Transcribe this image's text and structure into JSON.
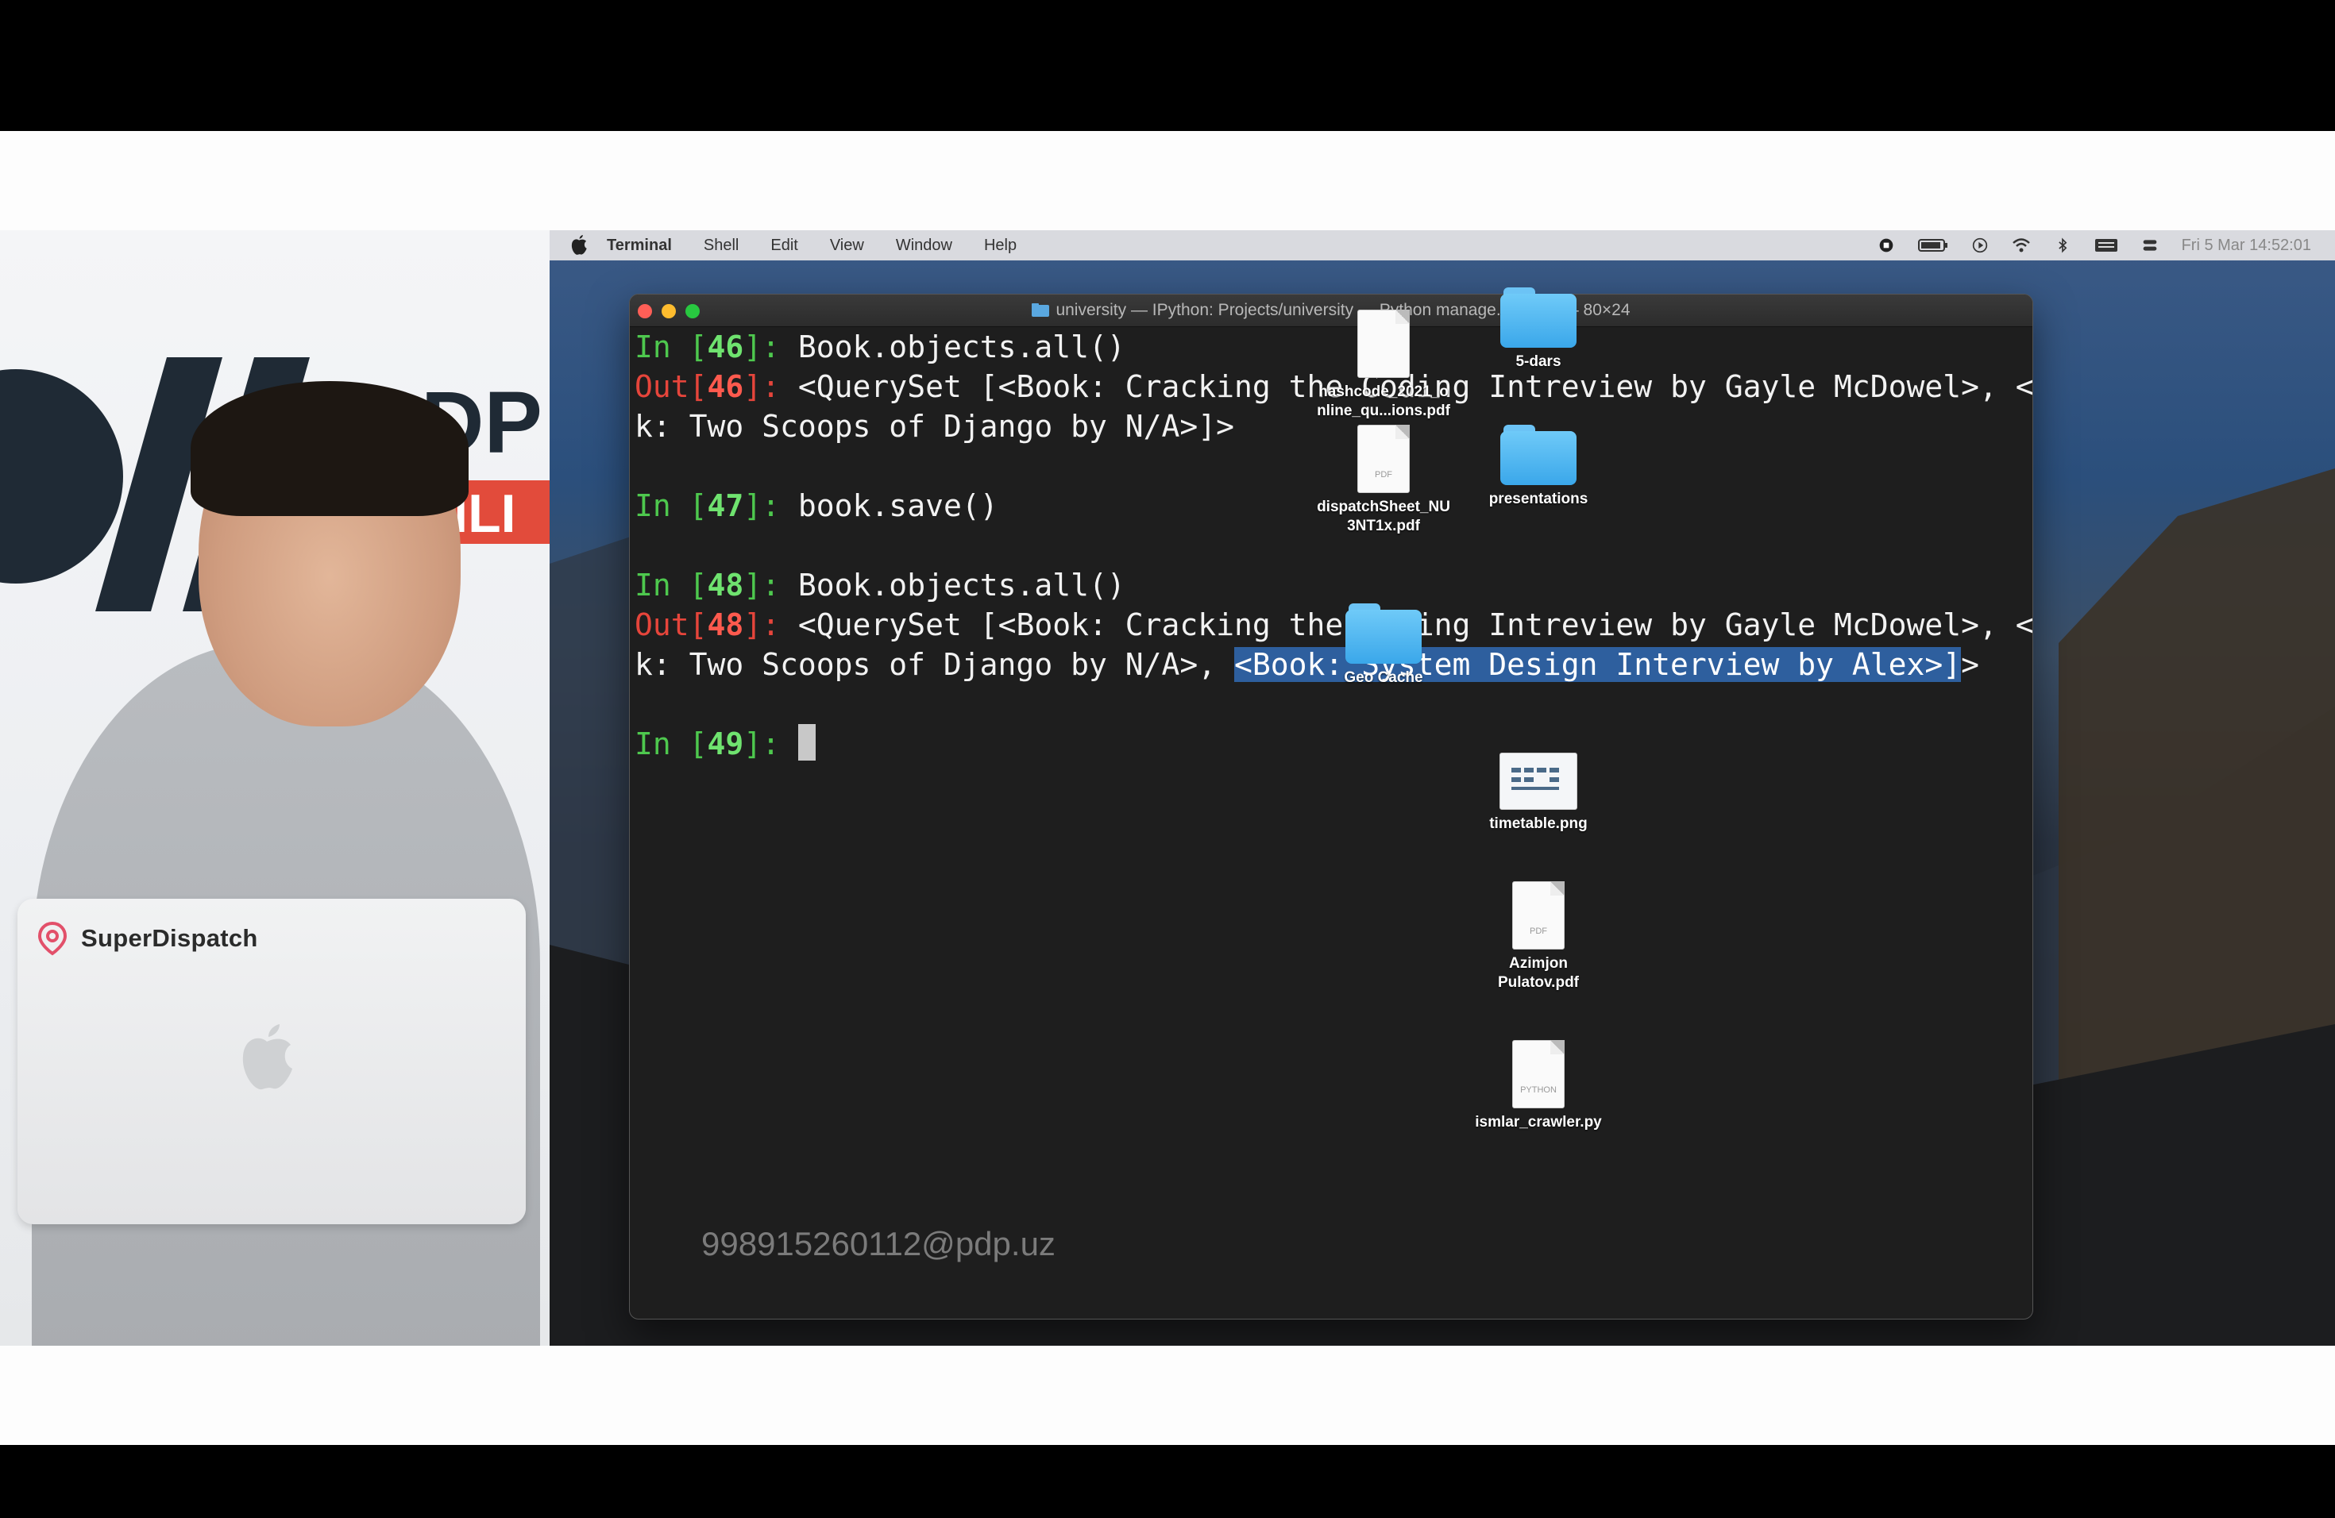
{
  "sticker": {
    "brand": "SuperDispatch"
  },
  "menubar": {
    "app": "Terminal",
    "items": [
      "Shell",
      "Edit",
      "View",
      "Window",
      "Help"
    ],
    "clock": "Fri 5 Mar  14:52:01"
  },
  "terminal": {
    "title": "university — IPython: Projects/university — Python manage.py shell — 80×24",
    "lines": [
      {
        "type": "in",
        "label": "In [",
        "num": "46",
        "close": "]: ",
        "text": "Book.objects.all()"
      },
      {
        "type": "out",
        "label": "Out[",
        "num": "46",
        "close": "]: ",
        "text": "<QuerySet [<Book: Cracking the Coding Intreview by Gayle McDowel>, <Boo"
      },
      {
        "type": "cont",
        "text": "k: Two Scoops of Django by N/A>]>"
      },
      {
        "type": "blank"
      },
      {
        "type": "in",
        "label": "In [",
        "num": "47",
        "close": "]: ",
        "text": "book.save()"
      },
      {
        "type": "blank"
      },
      {
        "type": "in",
        "label": "In [",
        "num": "48",
        "close": "]: ",
        "text": "Book.objects.all()"
      },
      {
        "type": "out",
        "label": "Out[",
        "num": "48",
        "close": "]: ",
        "text": "<QuerySet [<Book: Cracking the Coding Intreview by Gayle McDowel>, <Boo"
      },
      {
        "type": "cont_sel",
        "pre": "k: Two Scoops of Django by N/A>, ",
        "sel": "<Book: System Design Interview by Alex>]",
        "post": ">"
      },
      {
        "type": "blank"
      },
      {
        "type": "prompt",
        "label": "In [",
        "num": "49",
        "close": "]: "
      }
    ],
    "watermark": "998915260112@pdp.uz"
  },
  "desktop_icons": [
    {
      "name": "hashcode-pdf",
      "label": "hashcode_2021_o nline_qu...ions.pdf",
      "kind": "doc",
      "tag": ""
    },
    {
      "name": "5-dars-folder",
      "label": "5-dars",
      "kind": "folder"
    },
    {
      "name": "dispatch-pdf",
      "label": "dispatchSheet_NU 3NT1x.pdf",
      "kind": "doc",
      "tag": "PDF"
    },
    {
      "name": "presentations-folder",
      "label": "presentations",
      "kind": "folder"
    },
    {
      "name": "geo-cache-folder",
      "label": "Geo Cache",
      "kind": "folder"
    },
    {
      "name": "timetable-png",
      "label": "timetable.png",
      "kind": "image"
    },
    {
      "name": "azimjon-pdf",
      "label": "Azimjon Pulatov.pdf",
      "kind": "doc",
      "tag": "PDF"
    },
    {
      "name": "ismlar-py",
      "label": "ismlar_crawler.py",
      "kind": "doc",
      "tag": "PYTHON"
    }
  ]
}
